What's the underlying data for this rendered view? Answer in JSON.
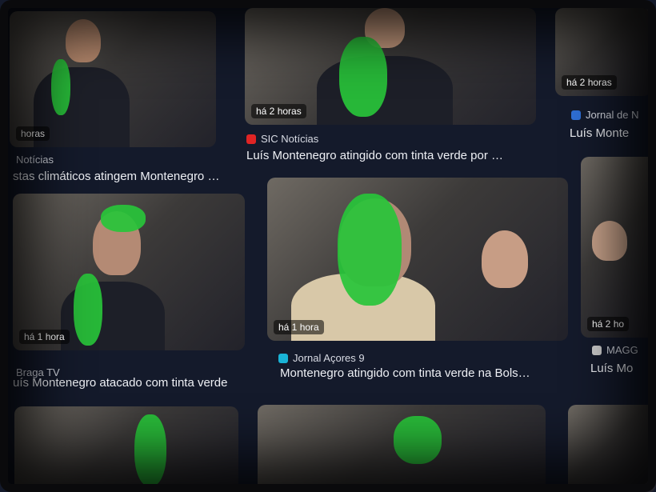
{
  "cards": [
    {
      "time": "horas",
      "source": "Notícias",
      "title": "stas climáticos atingem Montenegro …",
      "icon": "news-icon",
      "icon_color": "#888888"
    },
    {
      "time": "há 2 horas",
      "source": "SIC Notícias",
      "title": "Luís Montenegro atingido com tinta verde por …",
      "icon": "sic-icon",
      "icon_color": "#e02424"
    },
    {
      "time": "há 2 horas",
      "source": "Jornal de N",
      "title": "Luís Monte",
      "icon": "jn-icon",
      "icon_color": "#2f6fd6"
    },
    {
      "time": "há 1 hora",
      "source": "Braga TV",
      "title": "uís Montenegro atacado com tinta verde",
      "icon": "bragatv-icon",
      "icon_color": "#888888"
    },
    {
      "time": "há 1 hora",
      "source": "Jornal Açores 9",
      "title": "Montenegro atingido com tinta verde na Bols…",
      "icon": "acores9-icon",
      "icon_color": "#19b3d6"
    },
    {
      "time": "há 2 ho",
      "source": "MAGG",
      "title": "Luís Mo",
      "icon": "magg-icon",
      "icon_color": "#cfcfcf"
    }
  ],
  "accent": "#28c43a"
}
